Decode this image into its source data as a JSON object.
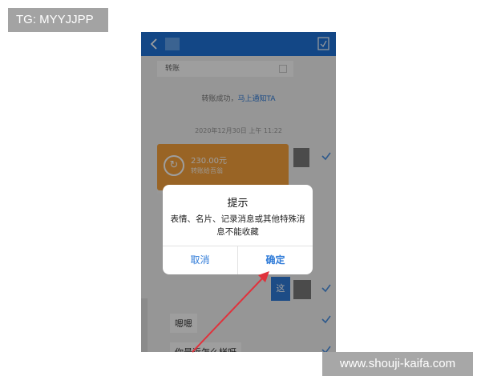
{
  "watermarks": {
    "tg": "TG: MYYJJPP",
    "site": "www.shouji-kaifa.com"
  },
  "chat": {
    "banner_label": "转账",
    "system_message": "转账成功，",
    "system_link": "马上通知TA",
    "timestamp": "2020年12月30日 上午 11:22",
    "transfer": {
      "amount": "230.00元",
      "status": "转账给吾翁",
      "icon": "transfer-refresh-icon"
    },
    "blue_message": "这",
    "messages": [
      "嗯嗯",
      "你最近怎么样呀"
    ]
  },
  "dialog": {
    "title": "提示",
    "message": "表情、名片、记录消息或其他特殊消息不能收藏",
    "cancel_label": "取消",
    "ok_label": "确定"
  },
  "colors": {
    "header_blue": "#1f73d9",
    "accent_blue": "#2f7bd8",
    "transfer_orange": "#f7a23c",
    "annotation_arrow": "#e0323c"
  }
}
